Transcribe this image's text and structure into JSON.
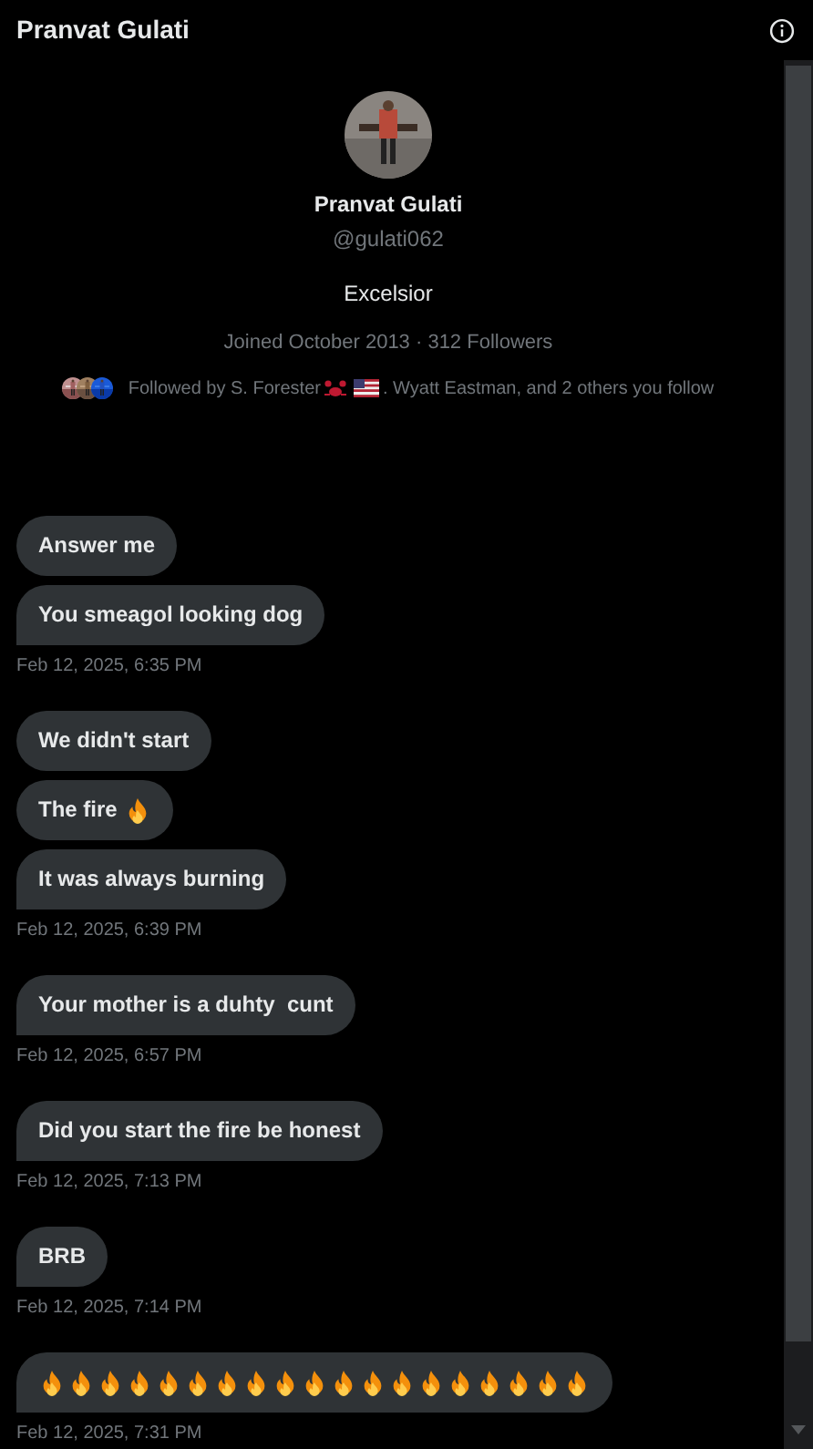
{
  "header": {
    "title": "Pranvat Gulati"
  },
  "profile": {
    "name": "Pranvat Gulati",
    "handle": "@gulati062",
    "bio": "Excelsior",
    "meta": "Joined October 2013 · 312 Followers",
    "followed_by": [
      {
        "kind": "text",
        "text": "Followed by S. Forester"
      },
      {
        "kind": "crab"
      },
      {
        "kind": "flag"
      },
      {
        "kind": "text",
        "text": ". Wyatt Eastman, and 2 others you follow"
      }
    ]
  },
  "groups": [
    {
      "messages": [
        [
          {
            "kind": "text",
            "text": "Answer me"
          }
        ],
        [
          {
            "kind": "text",
            "text": "You smeagol looking dog"
          }
        ]
      ],
      "time": "Feb 12, 2025, 6:35 PM"
    },
    {
      "messages": [
        [
          {
            "kind": "text",
            "text": "We didn't start"
          }
        ],
        [
          {
            "kind": "text",
            "text": "The fire"
          },
          {
            "kind": "fire"
          }
        ],
        [
          {
            "kind": "text",
            "text": "It was always burning"
          }
        ]
      ],
      "time": "Feb 12, 2025, 6:39 PM"
    },
    {
      "messages": [
        [
          {
            "kind": "text",
            "text": "Your mother is a duhty  cunt"
          }
        ]
      ],
      "time": "Feb 12, 2025, 6:57 PM"
    },
    {
      "messages": [
        [
          {
            "kind": "text",
            "text": "Did you start the fire be honest"
          }
        ]
      ],
      "time": "Feb 12, 2025, 7:13 PM"
    },
    {
      "messages": [
        [
          {
            "kind": "text",
            "text": "BRB"
          }
        ]
      ],
      "time": "Feb 12, 2025, 7:14 PM"
    },
    {
      "messages": [
        [
          {
            "kind": "fire"
          },
          {
            "kind": "fire"
          },
          {
            "kind": "fire"
          },
          {
            "kind": "fire"
          },
          {
            "kind": "fire"
          },
          {
            "kind": "fire"
          },
          {
            "kind": "fire"
          },
          {
            "kind": "fire"
          },
          {
            "kind": "fire"
          },
          {
            "kind": "fire"
          },
          {
            "kind": "fire"
          },
          {
            "kind": "fire"
          },
          {
            "kind": "fire"
          },
          {
            "kind": "fire"
          },
          {
            "kind": "fire"
          },
          {
            "kind": "fire"
          },
          {
            "kind": "fire"
          },
          {
            "kind": "fire"
          },
          {
            "kind": "fire"
          }
        ]
      ],
      "time": "Feb 12, 2025, 7:31 PM"
    }
  ]
}
